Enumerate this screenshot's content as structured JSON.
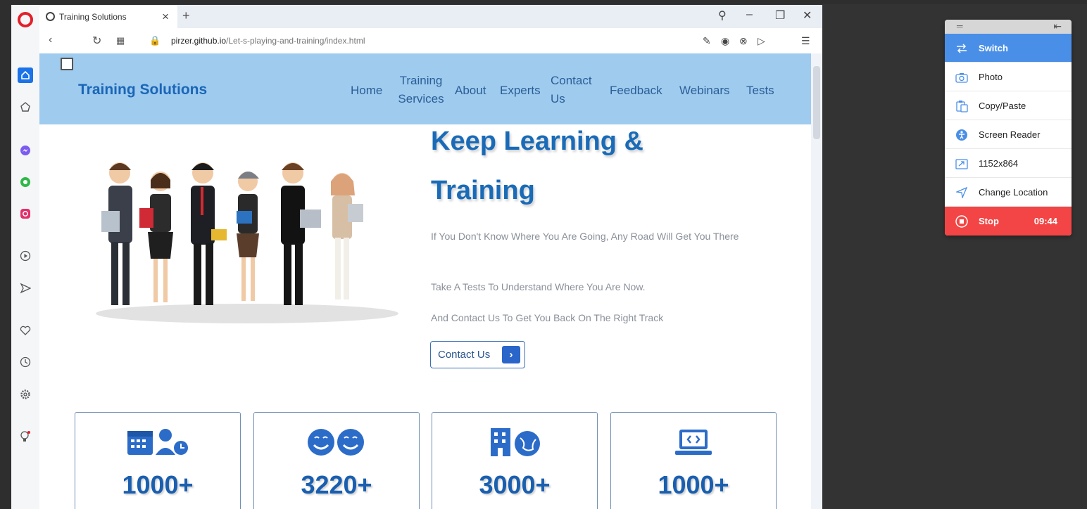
{
  "browser": {
    "tab_title": "Training Solutions",
    "url_host": "pirzer.github.io",
    "url_path": "/Let-s-playing-and-training/index.html"
  },
  "site": {
    "logo": "Training Solutions",
    "nav": [
      "Home",
      "Training Services",
      "About",
      "Experts",
      "Contact Us",
      "Feedback",
      "Webinars",
      "Tests"
    ],
    "hero": {
      "title_line1": "Keep Learning &",
      "title_line2": "Training",
      "text1": "If You Don't Know Where You Are Going, Any Road Will Get You There",
      "text2": "Take A Tests To Understand Where You Are Now.",
      "text3": "And Contact Us To Get You Back On The Right Track",
      "cta": "Contact Us"
    },
    "stats": [
      {
        "value": "1000+",
        "icon": "calendar-user-icon"
      },
      {
        "value": "3220+",
        "icon": "smiley-faces-icon"
      },
      {
        "value": "3000+",
        "icon": "building-globe-icon"
      },
      {
        "value": "1000+",
        "icon": "laptop-code-icon"
      }
    ]
  },
  "extension": {
    "items": [
      {
        "label": "Switch",
        "icon": "switch-icon"
      },
      {
        "label": "Photo",
        "icon": "camera-icon"
      },
      {
        "label": "Copy/Paste",
        "icon": "clipboard-icon"
      },
      {
        "label": "Screen Reader",
        "icon": "accessibility-icon"
      },
      {
        "label": "1152x864",
        "icon": "resize-icon"
      },
      {
        "label": "Change Location",
        "icon": "location-arrow-icon"
      }
    ],
    "stop_label": "Stop",
    "timer": "09:44"
  },
  "colors": {
    "header_bg": "#9fcbef",
    "brand_blue": "#1a6bb7",
    "switch_blue": "#4a8fe7",
    "stop_red": "#f34545"
  }
}
